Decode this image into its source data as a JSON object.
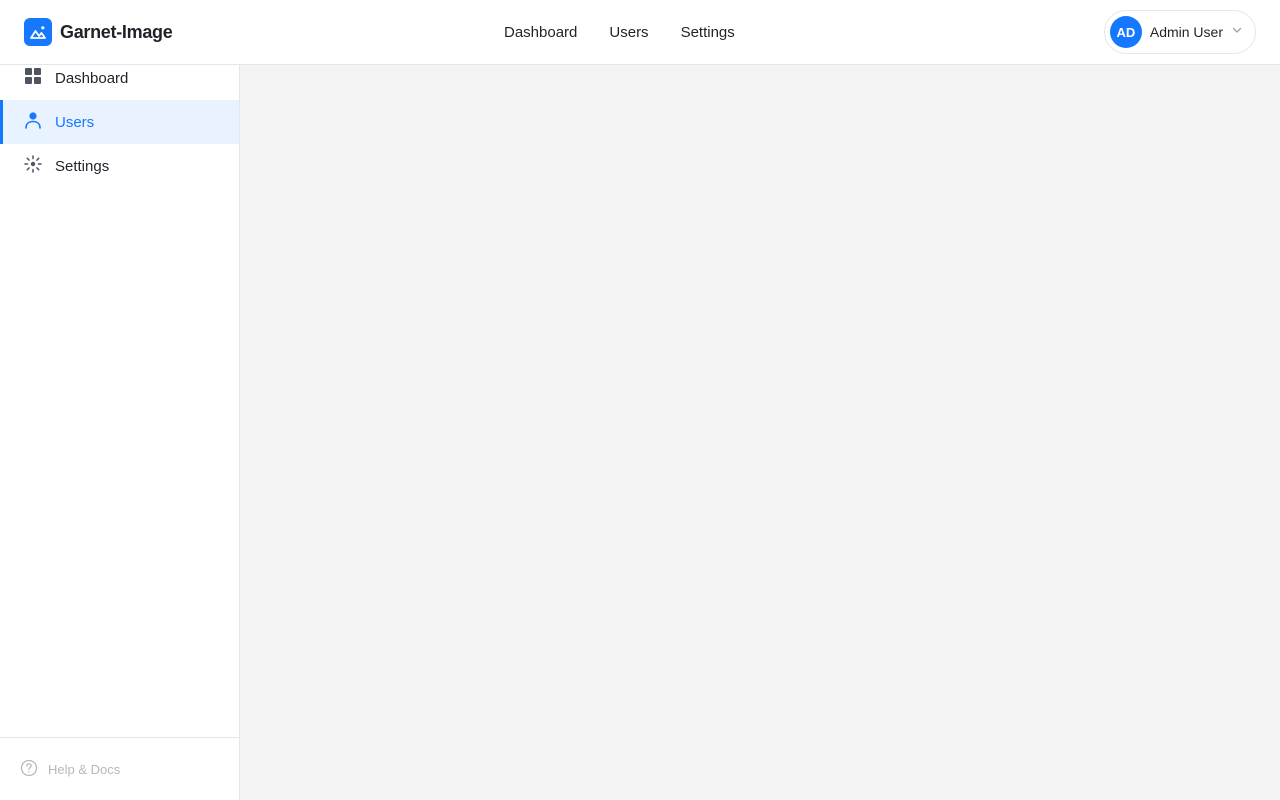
{
  "brand": {
    "name": "Garnet-Image",
    "logo_icon": "mountain-logo-icon",
    "accent": "#1677ff"
  },
  "top_nav": {
    "items": [
      {
        "label": "Dashboard"
      },
      {
        "label": "Users"
      },
      {
        "label": "Settings"
      }
    ]
  },
  "user_menu": {
    "initials": "AD",
    "name": "Admin User",
    "icon": "chevron-down-icon"
  },
  "sidebar": {
    "items": [
      {
        "label": "Dashboard",
        "icon": "dashboard-grid-icon",
        "active": false
      },
      {
        "label": "Users",
        "icon": "user-icon",
        "active": true
      },
      {
        "label": "Settings",
        "icon": "gear-icon",
        "active": false
      }
    ],
    "footer": {
      "label": "Help & Docs",
      "icon": "help-circle-icon"
    }
  },
  "colors": {
    "active_bg": "#e8f3ff",
    "active_text": "#1677ff",
    "muted": "#b5b8bf"
  }
}
